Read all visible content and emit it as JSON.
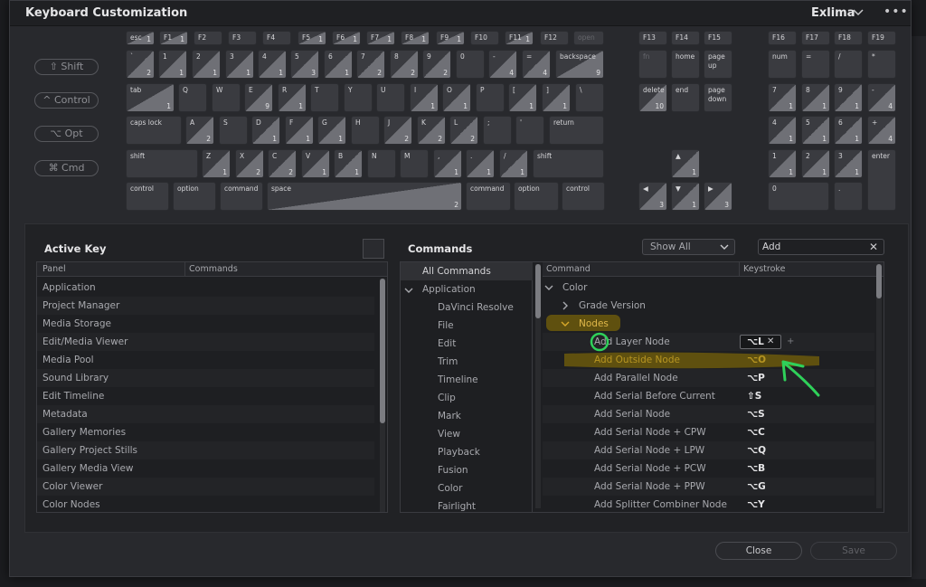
{
  "window": {
    "title": "Keyboard Customization",
    "preset": "Exlima",
    "more": "•••"
  },
  "modifiers": [
    "⇧ Shift",
    "^ Control",
    "⌥ Opt",
    "⌘ Cmd"
  ],
  "keyboard": {
    "fn_row": [
      {
        "label": "esc",
        "count": "1"
      },
      {
        "label": "F1",
        "count": "1"
      },
      {
        "label": "F2",
        "count": ""
      },
      {
        "label": "F3",
        "count": ""
      },
      {
        "label": "F4",
        "count": ""
      },
      {
        "label": "F5",
        "count": "1"
      },
      {
        "label": "F6",
        "count": "1"
      },
      {
        "label": "F7",
        "count": "1"
      },
      {
        "label": "F8",
        "count": "1"
      },
      {
        "label": "F9",
        "count": "1"
      },
      {
        "label": "F10",
        "count": ""
      },
      {
        "label": "F11",
        "count": "1"
      },
      {
        "label": "F12",
        "count": ""
      },
      {
        "label": "open",
        "count": ""
      }
    ],
    "num_row": [
      {
        "label": "`",
        "count": "2"
      },
      {
        "label": "1",
        "count": "1"
      },
      {
        "label": "2",
        "count": "1"
      },
      {
        "label": "3",
        "count": "1"
      },
      {
        "label": "4",
        "count": "1"
      },
      {
        "label": "5",
        "count": "3"
      },
      {
        "label": "6",
        "count": "1"
      },
      {
        "label": "7",
        "count": "2"
      },
      {
        "label": "8",
        "count": "2"
      },
      {
        "label": "9",
        "count": "2"
      },
      {
        "label": "0",
        "count": ""
      },
      {
        "label": "-",
        "count": "4"
      },
      {
        "label": "=",
        "count": "4"
      },
      {
        "label": "backspace",
        "count": "9"
      }
    ],
    "q_row": [
      {
        "label": "tab",
        "count": "1"
      },
      {
        "label": "Q",
        "count": ""
      },
      {
        "label": "W",
        "count": ""
      },
      {
        "label": "E",
        "count": "9"
      },
      {
        "label": "R",
        "count": "1"
      },
      {
        "label": "T",
        "count": ""
      },
      {
        "label": "Y",
        "count": ""
      },
      {
        "label": "U",
        "count": ""
      },
      {
        "label": "I",
        "count": "1"
      },
      {
        "label": "O",
        "count": "1"
      },
      {
        "label": "P",
        "count": ""
      },
      {
        "label": "[",
        "count": "1"
      },
      {
        "label": "]",
        "count": "1"
      },
      {
        "label": "\\",
        "count": ""
      }
    ],
    "a_row": [
      {
        "label": "caps lock",
        "count": ""
      },
      {
        "label": "A",
        "count": "2"
      },
      {
        "label": "S",
        "count": ""
      },
      {
        "label": "D",
        "count": "1"
      },
      {
        "label": "F",
        "count": "1"
      },
      {
        "label": "G",
        "count": "1"
      },
      {
        "label": "H",
        "count": ""
      },
      {
        "label": "J",
        "count": "2"
      },
      {
        "label": "K",
        "count": "2"
      },
      {
        "label": "L",
        "count": "2"
      },
      {
        "label": ";",
        "count": ""
      },
      {
        "label": "'",
        "count": ""
      },
      {
        "label": "return",
        "count": ""
      }
    ],
    "z_row": [
      {
        "label": "shift",
        "count": ""
      },
      {
        "label": "Z",
        "count": "1"
      },
      {
        "label": "X",
        "count": "2"
      },
      {
        "label": "C",
        "count": "2"
      },
      {
        "label": "V",
        "count": "1"
      },
      {
        "label": "B",
        "count": "1"
      },
      {
        "label": "N",
        "count": ""
      },
      {
        "label": "M",
        "count": ""
      },
      {
        "label": ",",
        "count": "1"
      },
      {
        "label": ".",
        "count": "1"
      },
      {
        "label": "/",
        "count": "1"
      },
      {
        "label": "shift",
        "count": ""
      }
    ],
    "space_row": [
      {
        "label": "control",
        "count": ""
      },
      {
        "label": "option",
        "count": ""
      },
      {
        "label": "command",
        "count": ""
      },
      {
        "label": "space",
        "count": "2"
      },
      {
        "label": "command",
        "count": ""
      },
      {
        "label": "option",
        "count": ""
      },
      {
        "label": "control",
        "count": ""
      }
    ],
    "nav_fn": [
      {
        "label": "F13",
        "count": ""
      },
      {
        "label": "F14",
        "count": ""
      },
      {
        "label": "F15",
        "count": ""
      }
    ],
    "nav_top": [
      {
        "label": "fn",
        "count": ""
      },
      {
        "label": "home",
        "count": ""
      },
      {
        "label": "page up",
        "count": ""
      }
    ],
    "nav_mid": [
      {
        "label": "delete",
        "count": "10"
      },
      {
        "label": "end",
        "count": ""
      },
      {
        "label": "page down",
        "count": ""
      }
    ],
    "arrows": [
      {
        "label": "▲",
        "count": "1"
      },
      {
        "label": "◀",
        "count": "3"
      },
      {
        "label": "▼",
        "count": "1"
      },
      {
        "label": "▶",
        "count": "3"
      }
    ],
    "pad_fn": [
      {
        "label": "F16",
        "count": ""
      },
      {
        "label": "F17",
        "count": ""
      },
      {
        "label": "F18",
        "count": ""
      },
      {
        "label": "F19",
        "count": ""
      }
    ],
    "pad_r1": [
      {
        "label": "num",
        "count": ""
      },
      {
        "label": "=",
        "count": ""
      },
      {
        "label": "/",
        "count": ""
      },
      {
        "label": "*",
        "count": ""
      }
    ],
    "pad_r2": [
      {
        "label": "7",
        "count": "1"
      },
      {
        "label": "8",
        "count": "1"
      },
      {
        "label": "9",
        "count": "1"
      },
      {
        "label": "-",
        "count": "4"
      }
    ],
    "pad_r3": [
      {
        "label": "4",
        "count": "1"
      },
      {
        "label": "5",
        "count": "1"
      },
      {
        "label": "6",
        "count": "1"
      },
      {
        "label": "+",
        "count": "4"
      }
    ],
    "pad_r4": [
      {
        "label": "1",
        "count": "1"
      },
      {
        "label": "2",
        "count": "1"
      },
      {
        "label": "3",
        "count": "1"
      },
      {
        "label": "enter",
        "count": ""
      }
    ],
    "pad_r5": [
      {
        "label": "0",
        "count": ""
      },
      {
        "label": ".",
        "count": ""
      }
    ]
  },
  "active_key": {
    "title": "Active Key",
    "columns": [
      "Panel",
      "Commands"
    ],
    "rows": [
      "Application",
      "Project Manager",
      "Media Storage",
      "Edit/Media Viewer",
      "Media Pool",
      "Sound Library",
      "Edit Timeline",
      "Metadata",
      "Gallery Memories",
      "Gallery Project Stills",
      "Gallery Media View",
      "Color Viewer",
      "Color Nodes"
    ]
  },
  "commands": {
    "title": "Commands",
    "filter": "Show All",
    "search": "Add",
    "tree": {
      "root": "All Commands",
      "group": "Application",
      "items": [
        "DaVinci Resolve",
        "File",
        "Edit",
        "Trim",
        "Timeline",
        "Clip",
        "Mark",
        "View",
        "Playback",
        "Fusion",
        "Color",
        "Fairlight"
      ]
    },
    "columns": [
      "Command",
      "Keystroke"
    ],
    "section": "Color",
    "sub_collapsed": "Grade Version",
    "sub_expanded": "Nodes",
    "rows": [
      {
        "name": "Add Layer Node",
        "key": "⌥L"
      },
      {
        "name": "Add Outside Node",
        "key": "⌥O"
      },
      {
        "name": "Add Parallel Node",
        "key": "⌥P"
      },
      {
        "name": "Add Serial Before Current",
        "key": "⇧S"
      },
      {
        "name": "Add Serial Node",
        "key": "⌥S"
      },
      {
        "name": "Add Serial Node + CPW",
        "key": "⌥C"
      },
      {
        "name": "Add Serial Node + LPW",
        "key": "⌥Q"
      },
      {
        "name": "Add Serial Node + PCW",
        "key": "⌥B"
      },
      {
        "name": "Add Serial Node + PPW",
        "key": "⌥G"
      },
      {
        "name": "Add Splitter Combiner Node",
        "key": "⌥Y"
      }
    ],
    "add_key": "+"
  },
  "footer": {
    "close": "Close",
    "save": "Save"
  },
  "colors": {
    "highlight": "#8a6d00",
    "annotation": "#2fd15a"
  }
}
